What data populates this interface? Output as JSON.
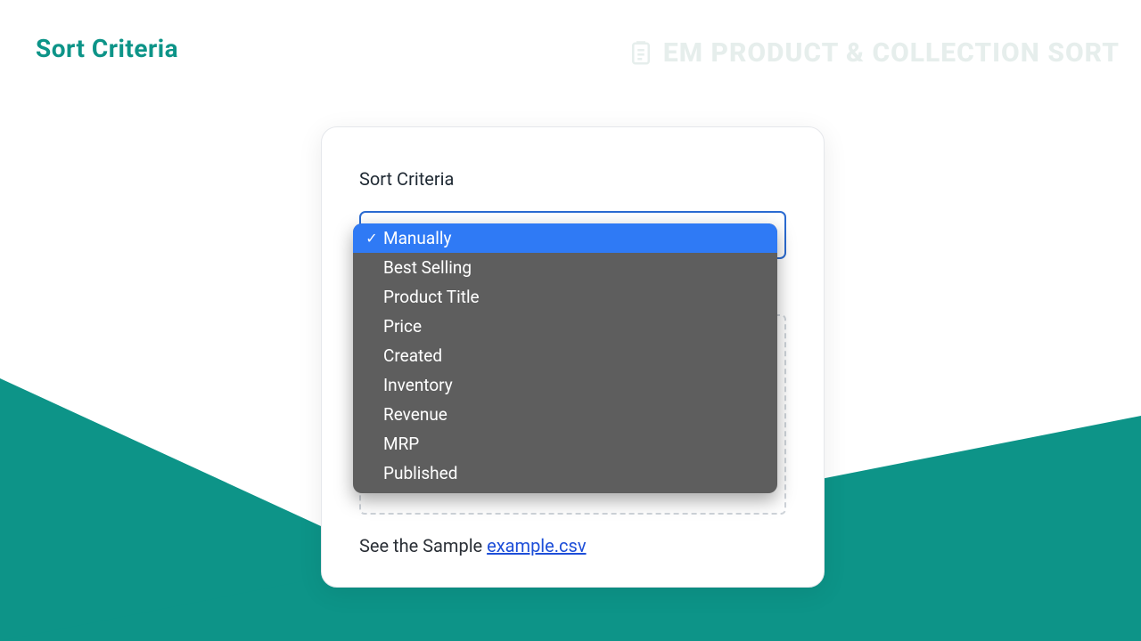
{
  "header": {
    "left_title": "Sort Criteria",
    "right_title": "EM PRODUCT & COLLECTION SORT"
  },
  "card": {
    "field_label": "Sort Criteria",
    "select_value": "Manually",
    "sample_prefix": "See the Sample ",
    "sample_link": "example.csv"
  },
  "dropdown": {
    "options": [
      {
        "label": "Manually",
        "selected": true
      },
      {
        "label": "Best Selling",
        "selected": false
      },
      {
        "label": "Product Title",
        "selected": false
      },
      {
        "label": "Price",
        "selected": false
      },
      {
        "label": "Created",
        "selected": false
      },
      {
        "label": "Inventory",
        "selected": false
      },
      {
        "label": "Revenue",
        "selected": false
      },
      {
        "label": "MRP",
        "selected": false
      },
      {
        "label": "Published",
        "selected": false
      }
    ]
  }
}
